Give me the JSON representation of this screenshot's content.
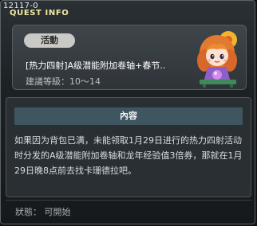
{
  "window": {
    "quest_id": "12117-0",
    "title": "QUEST INFO"
  },
  "quest": {
    "tag": "活動",
    "name": "[热力四射]A级潜能附加卷轴+春节..",
    "level_requirement": "建議等級：10～14",
    "npc_icon": "npc-girl-portrait-icon"
  },
  "content": {
    "header": "內容",
    "description": "如果因为背包已满，未能领取1月29日进行的热力四射活动时分发的A级潜能附加卷轴和龙年经验值3倍券，那就在1月29日晚8点前去找卡珊德拉吧。"
  },
  "status": {
    "text": "狀態： 可開始"
  },
  "colors": {
    "title": "#f4e9a3",
    "tag_bg": "#c9c9c6",
    "header_bg": "#3f5560"
  }
}
